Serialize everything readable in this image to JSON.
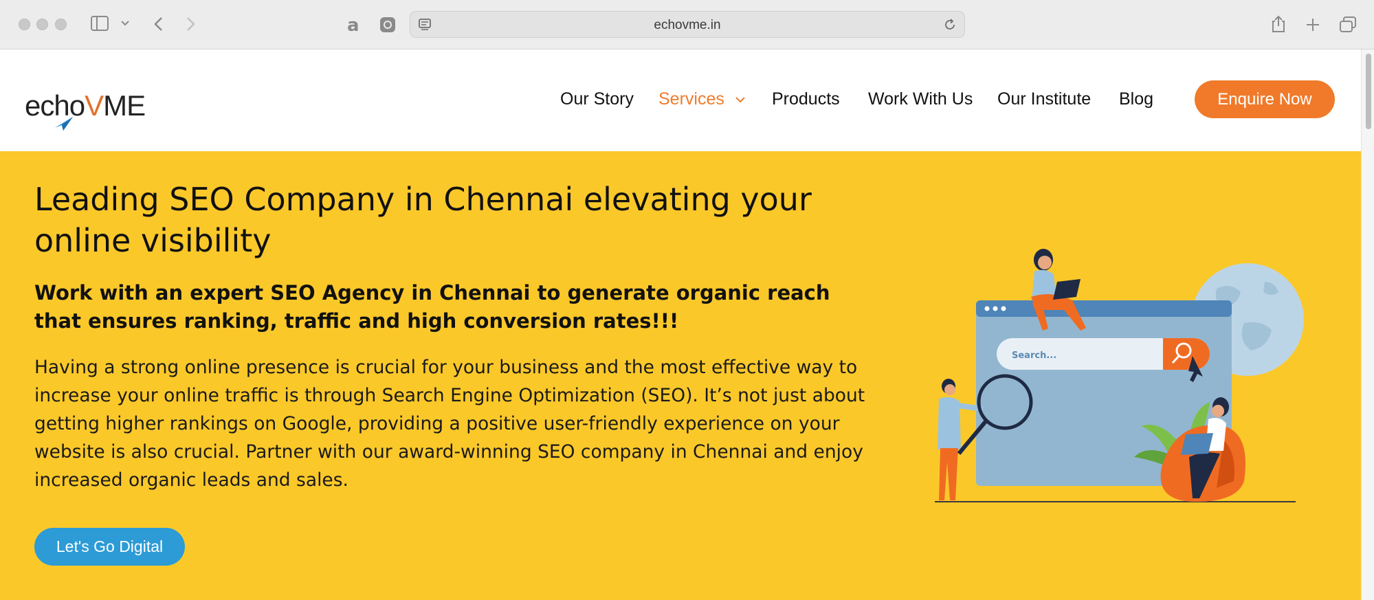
{
  "browser": {
    "url": "echovme.in"
  },
  "site": {
    "logo_text_a": "echo",
    "logo_text_b": "V",
    "logo_text_c": "ME",
    "nav": [
      {
        "label": "Our Story"
      },
      {
        "label": "Services"
      },
      {
        "label": "Products"
      },
      {
        "label": "Work With Us"
      },
      {
        "label": "Our Institute"
      },
      {
        "label": "Blog"
      }
    ],
    "cta_label": "Enquire Now"
  },
  "hero": {
    "title": "Leading SEO Company in Chennai elevating your online visibility",
    "subtitle": "Work with an expert SEO Agency in Chennai to generate organic reach that ensures ranking, traffic and high conversion rates!!!",
    "body": "Having a strong online presence is crucial for your business and the most effective way to increase your online traffic is through Search Engine Optimization (SEO). It’s not just about getting higher rankings on Google, providing a positive user-friendly experience on your website is also crucial. Partner with our award-winning SEO company in Chennai and enjoy increased organic leads and sales.",
    "button_label": "Let's Go Digital",
    "illustration_search_text": "Search..."
  },
  "colors": {
    "accent_orange": "#f07a2a",
    "hero_yellow": "#fbc82a",
    "button_blue": "#2c9bd6"
  }
}
